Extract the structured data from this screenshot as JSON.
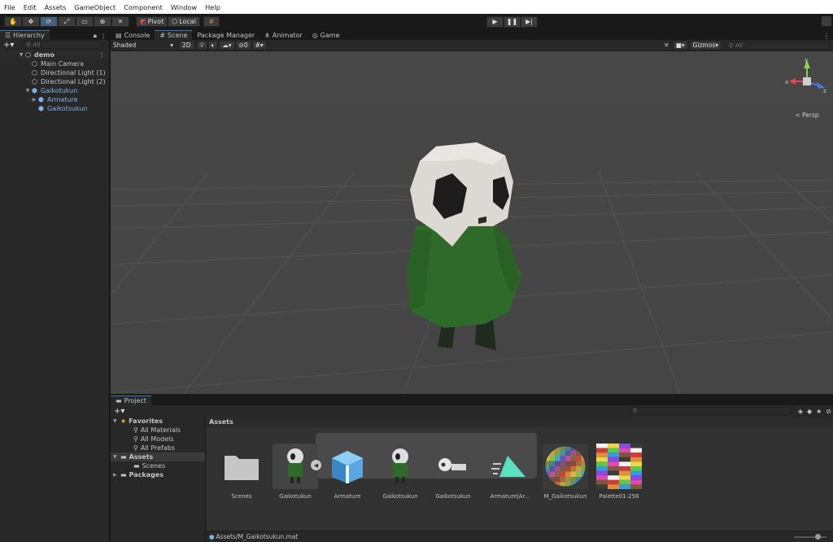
{
  "menu": [
    "File",
    "Edit",
    "Assets",
    "GameObject",
    "Component",
    "Window",
    "Help"
  ],
  "toolbar": {
    "tools": [
      "hand-tool",
      "move-tool",
      "rotate-tool",
      "scale-tool",
      "rect-tool",
      "transform-tool",
      "custom-tool"
    ],
    "pivot_label": "Pivot",
    "local_label": "Local"
  },
  "hierarchy": {
    "tab": "Hierarchy",
    "search_placeholder": "All",
    "rows": [
      {
        "label": "demo",
        "indent": 0,
        "type": "scene"
      },
      {
        "label": "Main Camera",
        "indent": 1,
        "type": "object"
      },
      {
        "label": "Directional Light (1)",
        "indent": 1,
        "type": "object"
      },
      {
        "label": "Directional Light (2)",
        "indent": 1,
        "type": "object"
      },
      {
        "label": "Gaikotukun",
        "indent": 1,
        "type": "prefab"
      },
      {
        "label": "Armature",
        "indent": 2,
        "type": "prefab"
      },
      {
        "label": "Gaikotsukun",
        "indent": 2,
        "type": "prefab"
      }
    ]
  },
  "scene_tabs": [
    "Console",
    "Scene",
    "Package Manager",
    "Animator",
    "Game"
  ],
  "scene_bar": {
    "shading": "Shaded",
    "mode_2d": "2D",
    "hidden_count": "0",
    "gizmos": "Gizmos",
    "search_placeholder": "All",
    "persp_label": "Persp"
  },
  "project": {
    "tab": "Project",
    "tree": [
      {
        "label": "Favorites",
        "indent": 0,
        "type": "favorites"
      },
      {
        "label": "All Materials",
        "indent": 1,
        "type": "search"
      },
      {
        "label": "All Models",
        "indent": 1,
        "type": "search"
      },
      {
        "label": "All Prefabs",
        "indent": 1,
        "type": "search"
      },
      {
        "label": "Assets",
        "indent": 0,
        "type": "folder",
        "selected": true
      },
      {
        "label": "Scenes",
        "indent": 1,
        "type": "folder"
      },
      {
        "label": "Packages",
        "indent": 0,
        "type": "folder"
      }
    ],
    "header": "Assets",
    "assets": [
      {
        "label": "Scenes",
        "kind": "folder"
      },
      {
        "label": "Gaikotukun",
        "kind": "model"
      },
      {
        "label": "Armature",
        "kind": "box"
      },
      {
        "label": "Gaikotsukun",
        "kind": "model"
      },
      {
        "label": "Gaikotsukun",
        "kind": "skull"
      },
      {
        "label": "Armature|Ar...",
        "kind": "anim"
      },
      {
        "label": "M_Gaikotsukun",
        "kind": "sphere"
      },
      {
        "label": "Palette01-256",
        "kind": "palette"
      }
    ],
    "status_path": "Assets/M_Gaikotsukun.mat"
  }
}
